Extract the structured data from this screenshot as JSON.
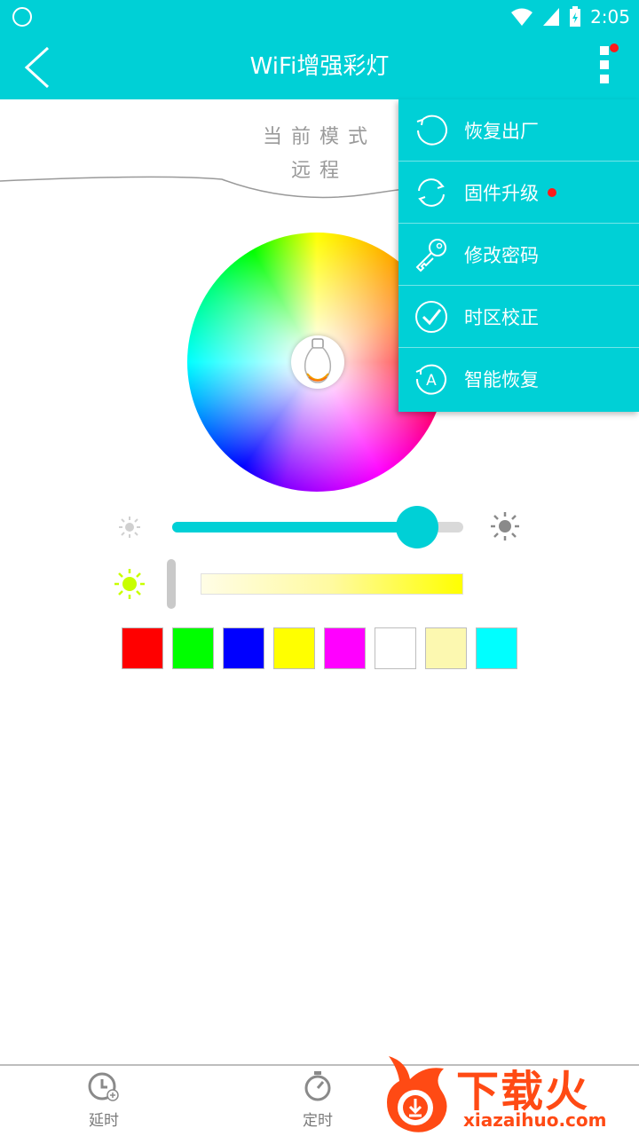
{
  "status_bar": {
    "time": "2:05"
  },
  "header": {
    "title": "WiFi增强彩灯"
  },
  "mode": {
    "label": "当前模式",
    "value": "远程"
  },
  "menu": {
    "items": [
      {
        "label": "恢复出厂",
        "icon": "restore-icon"
      },
      {
        "label": "固件升级",
        "icon": "firmware-update-icon",
        "badge": true
      },
      {
        "label": "修改密码",
        "icon": "key-icon"
      },
      {
        "label": "时区校正",
        "icon": "check-circle-icon"
      },
      {
        "label": "智能恢复",
        "icon": "smart-restore-icon"
      }
    ]
  },
  "brightness": {
    "value_fraction": 0.84
  },
  "color_temp": {
    "value_fraction": 0.0
  },
  "swatches": [
    "#ff0000",
    "#00ff00",
    "#0000ff",
    "#ffff00",
    "#ff00ff",
    "#ffffff",
    "#fcf8b0",
    "#00ffff"
  ],
  "bottom_nav": {
    "delay_label": "延时",
    "timer_label": "定时"
  },
  "watermark": {
    "text": "下载火",
    "url": "xiazaihuo.com"
  },
  "colors": {
    "accent": "#00d0d6",
    "badge": "#ff1a1a"
  }
}
